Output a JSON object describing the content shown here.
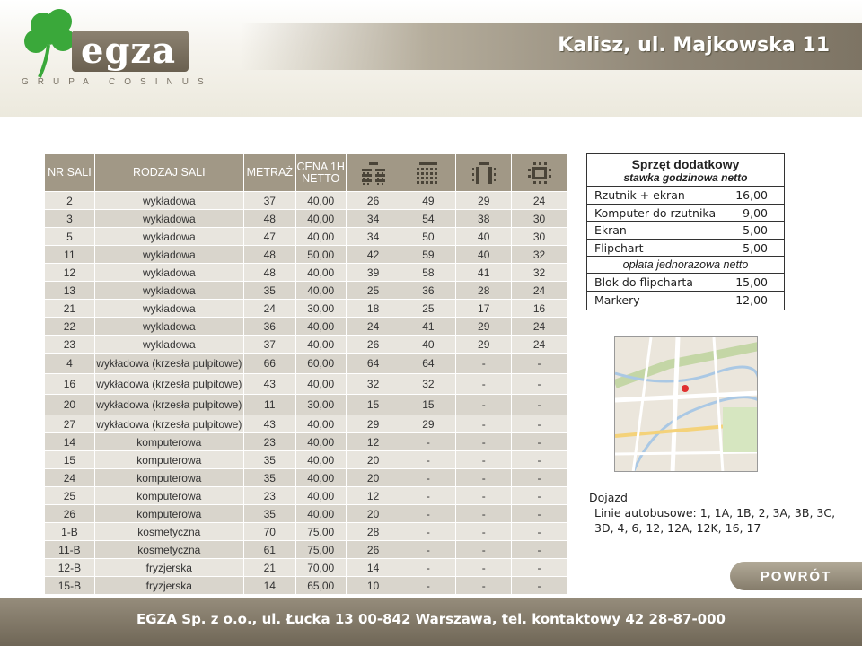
{
  "brand": {
    "name": "egza",
    "group": "GRUPA COSINUS"
  },
  "page_title": "Kalisz, ul. Majkowska 11",
  "table": {
    "headers": {
      "nr_sali": "NR SALI",
      "rodzaj_sali": "RODZAJ SALI",
      "metraz": "METRAŻ",
      "cena": "CENA 1H NETTO",
      "layout_icons": [
        "classroom-layout-icon",
        "theater-layout-icon",
        "u-shape-layout-icon",
        "boardroom-layout-icon"
      ]
    },
    "rows": [
      {
        "nr": "2",
        "type": "wykładowa",
        "area": "37",
        "price": "40,00",
        "c1": "26",
        "c2": "49",
        "c3": "29",
        "c4": "24"
      },
      {
        "nr": "3",
        "type": "wykładowa",
        "area": "48",
        "price": "40,00",
        "c1": "34",
        "c2": "54",
        "c3": "38",
        "c4": "30"
      },
      {
        "nr": "5",
        "type": "wykładowa",
        "area": "47",
        "price": "40,00",
        "c1": "34",
        "c2": "50",
        "c3": "40",
        "c4": "30"
      },
      {
        "nr": "11",
        "type": "wykładowa",
        "area": "48",
        "price": "50,00",
        "c1": "42",
        "c2": "59",
        "c3": "40",
        "c4": "32"
      },
      {
        "nr": "12",
        "type": "wykładowa",
        "area": "48",
        "price": "40,00",
        "c1": "39",
        "c2": "58",
        "c3": "41",
        "c4": "32"
      },
      {
        "nr": "13",
        "type": "wykładowa",
        "area": "35",
        "price": "40,00",
        "c1": "25",
        "c2": "36",
        "c3": "28",
        "c4": "24"
      },
      {
        "nr": "21",
        "type": "wykładowa",
        "area": "24",
        "price": "30,00",
        "c1": "18",
        "c2": "25",
        "c3": "17",
        "c4": "16"
      },
      {
        "nr": "22",
        "type": "wykładowa",
        "area": "36",
        "price": "40,00",
        "c1": "24",
        "c2": "41",
        "c3": "29",
        "c4": "24"
      },
      {
        "nr": "23",
        "type": "wykładowa",
        "area": "37",
        "price": "40,00",
        "c1": "26",
        "c2": "40",
        "c3": "29",
        "c4": "24"
      },
      {
        "nr": "4",
        "type": "wykładowa (krzesła pulpitowe)",
        "area": "66",
        "price": "60,00",
        "c1": "64",
        "c2": "64",
        "c3": "-",
        "c4": "-"
      },
      {
        "nr": "16",
        "type": "wykładowa (krzesła pulpitowe)",
        "area": "43",
        "price": "40,00",
        "c1": "32",
        "c2": "32",
        "c3": "-",
        "c4": "-"
      },
      {
        "nr": "20",
        "type": "wykładowa (krzesła pulpitowe)",
        "area": "11",
        "price": "30,00",
        "c1": "15",
        "c2": "15",
        "c3": "-",
        "c4": "-"
      },
      {
        "nr": "27",
        "type": "wykładowa (krzesła pulpitowe)",
        "area": "43",
        "price": "40,00",
        "c1": "29",
        "c2": "29",
        "c3": "-",
        "c4": "-"
      },
      {
        "nr": "14",
        "type": "komputerowa",
        "area": "23",
        "price": "40,00",
        "c1": "12",
        "c2": "-",
        "c3": "-",
        "c4": "-"
      },
      {
        "nr": "15",
        "type": "komputerowa",
        "area": "35",
        "price": "40,00",
        "c1": "20",
        "c2": "-",
        "c3": "-",
        "c4": "-"
      },
      {
        "nr": "24",
        "type": "komputerowa",
        "area": "35",
        "price": "40,00",
        "c1": "20",
        "c2": "-",
        "c3": "-",
        "c4": "-"
      },
      {
        "nr": "25",
        "type": "komputerowa",
        "area": "23",
        "price": "40,00",
        "c1": "12",
        "c2": "-",
        "c3": "-",
        "c4": "-"
      },
      {
        "nr": "26",
        "type": "komputerowa",
        "area": "35",
        "price": "40,00",
        "c1": "20",
        "c2": "-",
        "c3": "-",
        "c4": "-"
      },
      {
        "nr": "1-B",
        "type": "kosmetyczna",
        "area": "70",
        "price": "75,00",
        "c1": "28",
        "c2": "-",
        "c3": "-",
        "c4": "-"
      },
      {
        "nr": "11-B",
        "type": "kosmetyczna",
        "area": "61",
        "price": "75,00",
        "c1": "26",
        "c2": "-",
        "c3": "-",
        "c4": "-"
      },
      {
        "nr": "12-B",
        "type": "fryzjerska",
        "area": "21",
        "price": "70,00",
        "c1": "14",
        "c2": "-",
        "c3": "-",
        "c4": "-"
      },
      {
        "nr": "15-B",
        "type": "fryzjerska",
        "area": "14",
        "price": "65,00",
        "c1": "10",
        "c2": "-",
        "c3": "-",
        "c4": "-"
      }
    ]
  },
  "equipment": {
    "title": "Sprzęt dodatkowy",
    "subtitle": "stawka godzinowa netto",
    "hourly": [
      {
        "label": "Rzutnik + ekran",
        "price": "16,00"
      },
      {
        "label": "Komputer do rzutnika",
        "price": "9,00"
      },
      {
        "label": "Ekran",
        "price": "5,00"
      },
      {
        "label": "Flipchart",
        "price": "5,00"
      }
    ],
    "one_time_note": "opłata jednorazowa netto",
    "one_time": [
      {
        "label": "Blok do flipcharta",
        "price": "15,00"
      },
      {
        "label": "Markery",
        "price": "12,00"
      }
    ]
  },
  "map": {
    "icon": "location-map",
    "pin_color": "#e03030"
  },
  "directions": {
    "title": "Dojazd",
    "text": "Linie autobusowe: 1, 1A, 1B, 2, 3A, 3B, 3C, 3D, 4, 6, 12, 12A, 12K, 16, 17"
  },
  "back_button": "POWRÓT",
  "footer": "EGZA Sp. z o.o., ul. Łucka 13 00-842 Warszawa, tel. kontaktowy 42 28-87-000",
  "colors": {
    "header_bg": "#a19886",
    "row_light": "#e8e5de",
    "row_dark": "#d9d5cc",
    "footer_bg": "#857c6b",
    "clover_green": "#3aa83a"
  }
}
